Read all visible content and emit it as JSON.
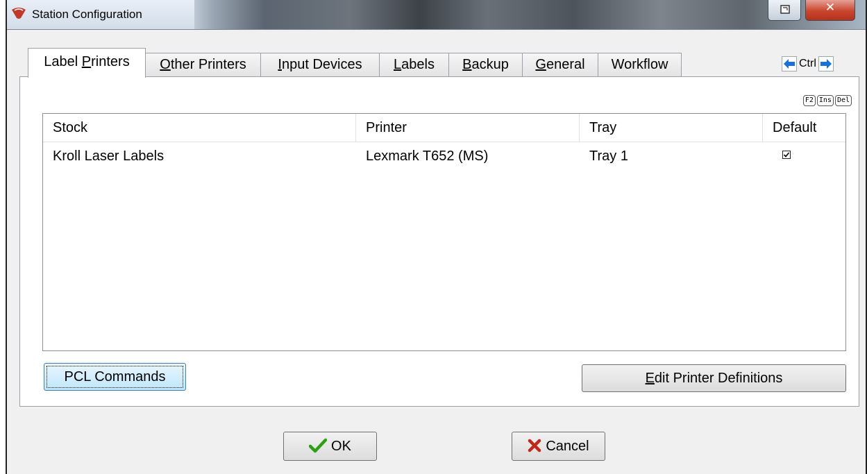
{
  "window": {
    "title": "Station Configuration"
  },
  "tabs": [
    {
      "label_pre": "Label ",
      "label_u": "P",
      "label_post": "rinters"
    },
    {
      "label_pre": "",
      "label_u": "O",
      "label_post": "ther Printers"
    },
    {
      "label_pre": "",
      "label_u": "I",
      "label_post": "nput Devices"
    },
    {
      "label_pre": "",
      "label_u": "L",
      "label_post": "abels"
    },
    {
      "label_pre": "",
      "label_u": "B",
      "label_post": "ackup"
    },
    {
      "label_pre": "",
      "label_u": "G",
      "label_post": "eneral"
    },
    {
      "label_pre": "",
      "label_u": "",
      "label_post": "Workflow"
    }
  ],
  "nav": {
    "ctrl_label": "Ctrl"
  },
  "keys": [
    "F2",
    "Ins",
    "Del"
  ],
  "grid": {
    "columns": [
      "Stock",
      "Printer",
      "Tray",
      "Default"
    ],
    "rows": [
      {
        "stock": "Kroll Laser Labels",
        "printer": "Lexmark T652 (MS)",
        "tray": "Tray 1",
        "default": true
      }
    ]
  },
  "buttons": {
    "pcl": "PCL Commands",
    "edit_u": "E",
    "edit_rest": "dit Printer Definitions",
    "ok": "OK",
    "cancel": "Cancel"
  },
  "colors": {
    "ok_check": "#2f9e17",
    "cancel_x": "#c0281a",
    "arrow_blue": "#1a6fd8"
  }
}
